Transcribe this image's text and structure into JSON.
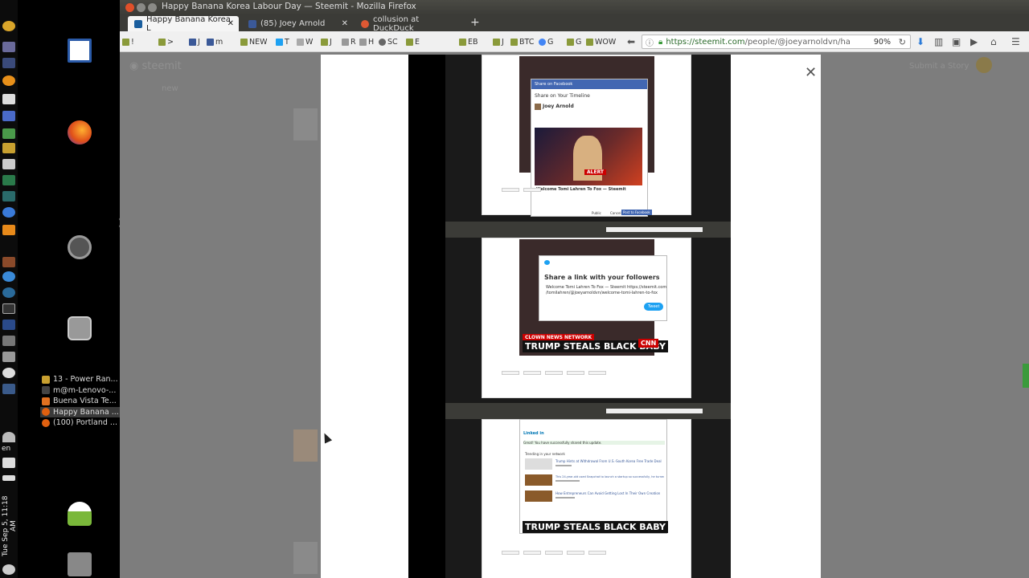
{
  "system": {
    "clock": "Tue Sep 5, 11:18 AM",
    "language": "en"
  },
  "launcher": {
    "window_list": [
      {
        "label": "13 - Power Ran...",
        "color": "#c8a030"
      },
      {
        "label": "m@m-Lenovo-...",
        "color": "#444444"
      },
      {
        "label": "Buena Vista Te...",
        "color": "#e07020"
      },
      {
        "label": "Happy Banana ...",
        "color": "#e06010"
      },
      {
        "label": "(100) Portland ...",
        "color": "#e06010"
      }
    ]
  },
  "window": {
    "title": "Happy Banana Korea Labour Day — Steemit - Mozilla Firefox"
  },
  "tabs": [
    {
      "label": "Happy Banana Korea L",
      "active": true,
      "color": "#1a5e9e"
    },
    {
      "label": "(85) Joey Arnold",
      "active": false,
      "color": "#3b5998"
    },
    {
      "label": "collusion at DuckDuck",
      "active": false,
      "color": "#de5833"
    }
  ],
  "bookmarks": [
    "!",
    ">",
    "J",
    "m",
    "NEW",
    "T",
    "W",
    "J",
    "R",
    "H",
    "SC",
    "E",
    "EB",
    "J",
    "BTC",
    "G",
    "G",
    "WOW"
  ],
  "url": {
    "host": "https://steemit.com",
    "path": "/people/@joeyarnoldvn/ha",
    "zoom": "90%"
  },
  "background_page": {
    "submit": "Submit a Story",
    "nav_new": "new"
  },
  "embedded": {
    "facebook": {
      "header": "Share on Facebook",
      "sub": "Share on Your Timeline",
      "user": "Joey Arnold",
      "alert": "ALERT",
      "link_title": "Welcome Tomi Lahren To Fox — Steemit",
      "post_btn": "Post to Facebook",
      "cancel": "Cancel",
      "public": "Public"
    },
    "twitter": {
      "title": "Share a link with your followers",
      "text1": "Welcome Tomi Lahren To Fox — Steemit https://steemit.com",
      "text2": "/tomilahren/@joeyarnoldvn/welcome-tomi-lahren-to-fox",
      "tweet_btn": "Tweet"
    },
    "banner1": "CLOWN NEWS NETWORK",
    "headline": "TRUMP STEALS BLACK BABY",
    "network": "CNN",
    "linkedin": {
      "logo": "Linked in",
      "notice": "Great! You have successfully shared this update.",
      "trending": "Trending in your network",
      "items": [
        "Trump Hints at Withdrawal From U.S.-South Korea Free Trade Deal",
        "This 24-year-old used Snapchat to launch a startup so successfully, he turned down job at Facebook and Uber — all while fighting cancer",
        "How Entrepreneurs Can Avoid Getting Lost In Their Own Creation"
      ]
    }
  }
}
